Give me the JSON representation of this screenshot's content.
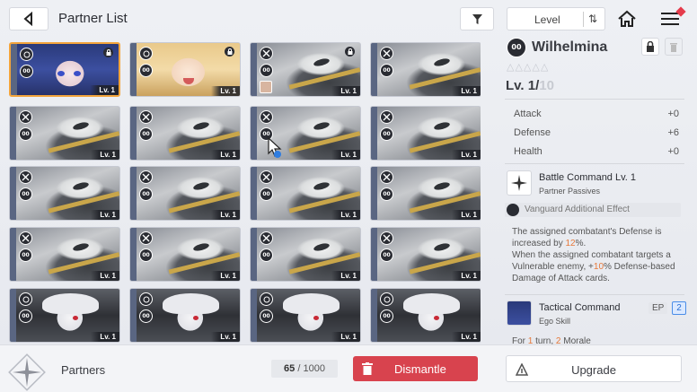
{
  "header": {
    "title": "Partner List",
    "sort_label": "Level",
    "sort_arrows": "⇅"
  },
  "grid": {
    "cards": [
      {
        "art": "girl-blue",
        "grade": "00",
        "lv": "Lv. 1",
        "locked": true,
        "selected": true,
        "mini": false
      },
      {
        "art": "girl-blonde",
        "grade": "00",
        "lv": "Lv. 1",
        "locked": true,
        "selected": false,
        "mini": false
      },
      {
        "art": "robot",
        "grade": "00",
        "lv": "Lv. 1",
        "locked": true,
        "selected": false,
        "mini": true
      },
      {
        "art": "robot",
        "grade": "00",
        "lv": "Lv. 1",
        "locked": false,
        "selected": false,
        "mini": false
      },
      {
        "art": "robot",
        "grade": "00",
        "lv": "Lv. 1",
        "locked": false,
        "selected": false,
        "mini": false
      },
      {
        "art": "robot",
        "grade": "00",
        "lv": "Lv. 1",
        "locked": false,
        "selected": false,
        "mini": false
      },
      {
        "art": "robot",
        "grade": "00",
        "lv": "Lv. 1",
        "locked": false,
        "selected": false,
        "mini": false
      },
      {
        "art": "robot",
        "grade": "00",
        "lv": "Lv. 1",
        "locked": false,
        "selected": false,
        "mini": false
      },
      {
        "art": "robot",
        "grade": "00",
        "lv": "Lv. 1",
        "locked": false,
        "selected": false,
        "mini": false
      },
      {
        "art": "robot",
        "grade": "00",
        "lv": "Lv. 1",
        "locked": false,
        "selected": false,
        "mini": false
      },
      {
        "art": "robot",
        "grade": "00",
        "lv": "Lv. 1",
        "locked": false,
        "selected": false,
        "mini": false
      },
      {
        "art": "robot",
        "grade": "00",
        "lv": "Lv. 1",
        "locked": false,
        "selected": false,
        "mini": false
      },
      {
        "art": "robot",
        "grade": "00",
        "lv": "Lv. 1",
        "locked": false,
        "selected": false,
        "mini": false
      },
      {
        "art": "robot",
        "grade": "00",
        "lv": "Lv. 1",
        "locked": false,
        "selected": false,
        "mini": false
      },
      {
        "art": "robot",
        "grade": "00",
        "lv": "Lv. 1",
        "locked": false,
        "selected": false,
        "mini": false
      },
      {
        "art": "robot",
        "grade": "00",
        "lv": "Lv. 1",
        "locked": false,
        "selected": false,
        "mini": false
      },
      {
        "art": "white",
        "grade": "00",
        "lv": "Lv. 1",
        "locked": false,
        "selected": false,
        "mini": false
      },
      {
        "art": "white",
        "grade": "00",
        "lv": "Lv. 1",
        "locked": false,
        "selected": false,
        "mini": false
      },
      {
        "art": "white",
        "grade": "00",
        "lv": "Lv. 1",
        "locked": false,
        "selected": false,
        "mini": false
      },
      {
        "art": "white",
        "grade": "00",
        "lv": "Lv. 1",
        "locked": false,
        "selected": false,
        "mini": false
      }
    ]
  },
  "detail": {
    "grade": "00",
    "name": "Wilhelmina",
    "stars": "△△△△△",
    "level_current": "Lv. 1/",
    "level_max": "10",
    "stats": [
      {
        "name": "Attack",
        "value": "+0"
      },
      {
        "name": "Defense",
        "value": "+6"
      },
      {
        "name": "Health",
        "value": "+0"
      }
    ],
    "skill1": {
      "title": "Battle Command Lv. 1",
      "subtitle": "Partner Passives"
    },
    "vanguard_label": "Vanguard Additional Effect",
    "desc": {
      "p1_a": "The assigned combatant's Defense is increased by ",
      "p1_hl": "12",
      "p1_b": "%.",
      "p2_a": "When the assigned combatant targets a Vulnerable enemy, +",
      "p2_hl": "10",
      "p2_b": "% Defense-based Damage of Attack cards."
    },
    "skill2": {
      "title": "Tactical Command",
      "subtitle": "Ego Skill",
      "ep_label": "EP",
      "ep_value": "2"
    },
    "cut_text_a": "For ",
    "cut_hl1": "1",
    "cut_text_b": " turn, ",
    "cut_hl2": "2",
    "cut_text_c": " Morale"
  },
  "footer": {
    "label": "Partners",
    "count_current": "65",
    "count_sep": " / ",
    "count_max": "1000",
    "dismantle_label": "Dismantle",
    "upgrade_label": "Upgrade"
  },
  "colors": {
    "accent_red": "#d8434e",
    "selected_border": "#f3a43b",
    "highlight_orange": "#e6783a",
    "ep_blue": "#2a6fd4"
  }
}
